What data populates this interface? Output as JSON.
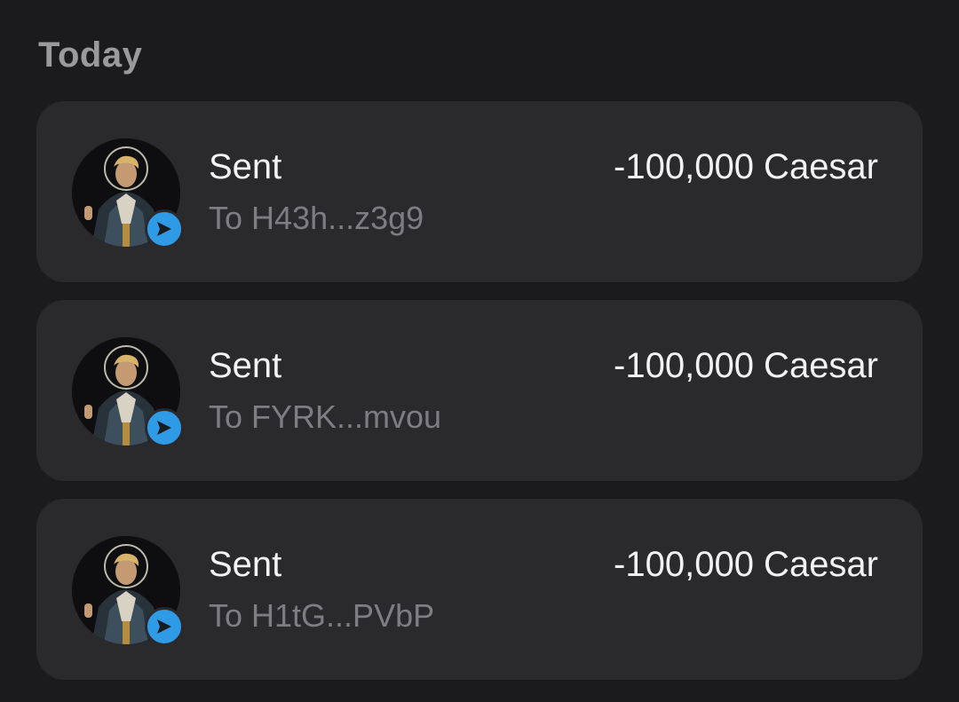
{
  "section": {
    "title": "Today"
  },
  "transactions": [
    {
      "type": "Sent",
      "to": "To H43h...z3g9",
      "amount": "-100,000 Caesar",
      "badge_icon": "send-arrow-icon",
      "badge_color": "#2f9ae6"
    },
    {
      "type": "Sent",
      "to": "To FYRK...mvou",
      "amount": "-100,000 Caesar",
      "badge_icon": "send-arrow-icon",
      "badge_color": "#2f9ae6"
    },
    {
      "type": "Sent",
      "to": "To H1tG...PVbP",
      "amount": "-100,000 Caesar",
      "badge_icon": "send-arrow-icon",
      "badge_color": "#2f9ae6"
    }
  ],
  "colors": {
    "background": "#1b1b1d",
    "card": "#2a2a2d",
    "primary_text": "#f2f2f4",
    "secondary_text": "#7d7d82",
    "section_title": "#9a9a9c",
    "accent": "#2f9ae6"
  }
}
